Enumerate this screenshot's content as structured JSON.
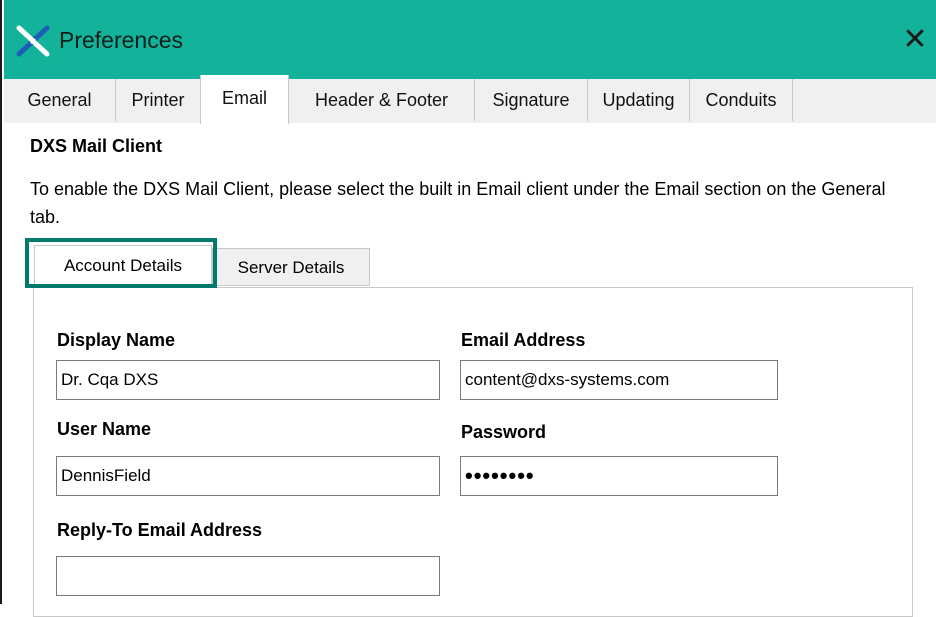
{
  "window": {
    "title": "Preferences",
    "close_glyph": "✕",
    "title_bar_color": "#12b39a"
  },
  "tabs": [
    {
      "label": "General"
    },
    {
      "label": "Printer"
    },
    {
      "label": "Email"
    },
    {
      "label": "Header & Footer"
    },
    {
      "label": "Signature"
    },
    {
      "label": "Updating"
    },
    {
      "label": "Conduits"
    }
  ],
  "active_tab": "Email",
  "email": {
    "section_title": "DXS Mail Client",
    "info_text": "To enable the DXS Mail Client, please select the built in Email client under the Email section on the General tab.",
    "subtabs": [
      {
        "label": "Account Details"
      },
      {
        "label": "Server Details"
      }
    ],
    "active_subtab": "Account Details",
    "highlight_color": "#007a6b",
    "fields": {
      "display_name": {
        "label": "Display Name",
        "value": "Dr. Cqa DXS"
      },
      "email_address": {
        "label": "Email Address",
        "value": "content@dxs-systems.com"
      },
      "user_name": {
        "label": "User Name",
        "value": "DennisField"
      },
      "password": {
        "label": "Password",
        "value": "••••••••"
      },
      "reply_to": {
        "label": "Reply-To Email Address",
        "value": ""
      }
    }
  }
}
